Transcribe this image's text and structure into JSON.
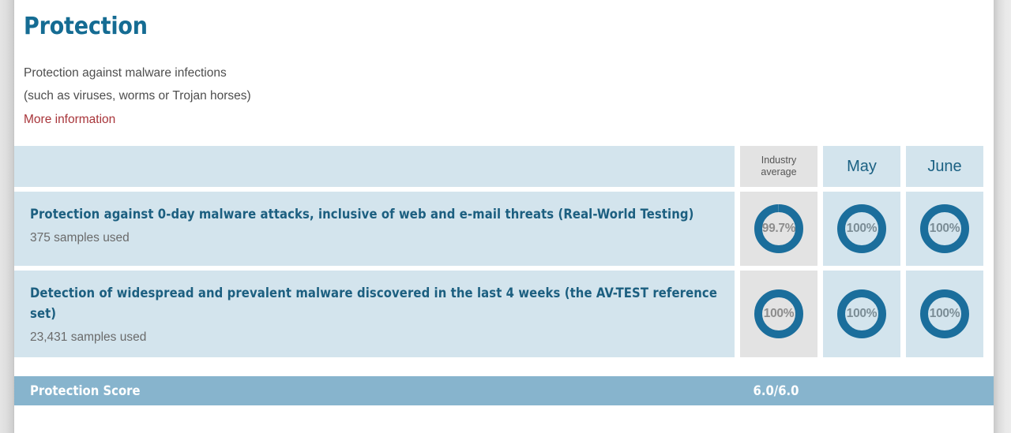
{
  "section": {
    "title": "Protection",
    "description_line1": "Protection against malware infections",
    "description_line2": "(such as viruses, worms or Trojan horses)",
    "more_info_label": "More information"
  },
  "table": {
    "columns": [
      {
        "key": "industry",
        "label": "Industry average",
        "label_line1": "Industry",
        "label_line2": "average",
        "background": "#e3e3e3"
      },
      {
        "key": "may",
        "label": "May",
        "background": "#d3e4ed"
      },
      {
        "key": "june",
        "label": "June",
        "background": "#d3e4ed"
      }
    ],
    "rows": [
      {
        "title": "Protection against 0-day malware attacks, inclusive of web and e-mail threats (Real-World Testing)",
        "samples": "375 samples used",
        "values": {
          "industry": "99.7%",
          "may": "100%",
          "june": "100%"
        },
        "percents": {
          "industry": 99.7,
          "may": 100,
          "june": 100
        }
      },
      {
        "title": "Detection of widespread and prevalent malware discovered in the last 4 weeks (the AV-TEST reference set)",
        "samples": "23,431 samples used",
        "values": {
          "industry": "100%",
          "may": "100%",
          "june": "100%"
        },
        "percents": {
          "industry": 100,
          "may": 100,
          "june": 100
        }
      }
    ]
  },
  "score": {
    "label": "Protection Score",
    "value": "6.0/6.0"
  },
  "colors": {
    "heading": "#156c93",
    "link": "#a8353a",
    "row_background": "#d3e4ed",
    "industry_background": "#e3e3e3",
    "donut_ring": "#1b6e9c",
    "donut_track": "#ffffff",
    "score_bar": "#87b4cd",
    "page_background": "#e8e8e8"
  }
}
